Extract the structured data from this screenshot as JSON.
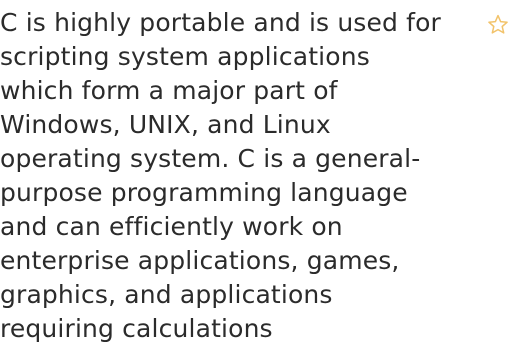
{
  "colors": {
    "text": "#2b2b2b",
    "star_outline": "#f2c36b"
  },
  "favorite": {
    "icon": "star-outline-icon",
    "state": "unselected"
  },
  "paragraph": {
    "lines": [
      "C is highly portable and is used for",
      "scripting system applications",
      "which form a major part of",
      "Windows, UNIX, and Linux",
      "operating system. C is a general-",
      "purpose programming language",
      "and can efficiently work on",
      "enterprise applications, games,",
      "graphics, and applications",
      "requiring calculations"
    ]
  }
}
